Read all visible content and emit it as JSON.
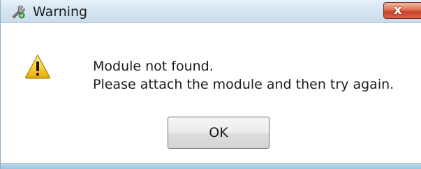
{
  "window": {
    "title": "Warning",
    "title_icon": "app-wrench-icon",
    "close_glyph": "x",
    "close_color": "#c7432a"
  },
  "message": {
    "icon": "warning-triangle-icon",
    "line1": "Module not found.",
    "line2": "Please attach the module and then try again."
  },
  "buttons": {
    "ok_label": "OK"
  }
}
